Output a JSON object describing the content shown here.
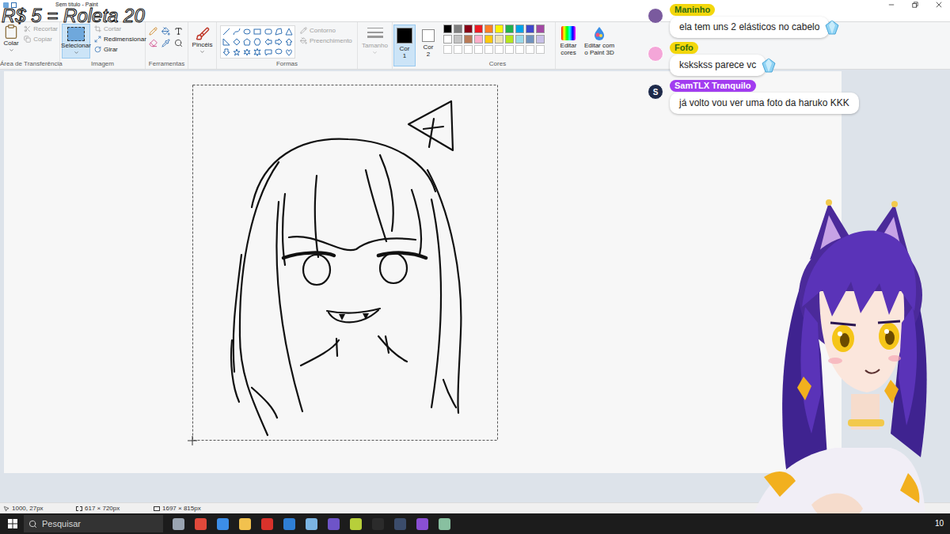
{
  "overlay": {
    "text": "R$ 5 = Roleta 20"
  },
  "window": {
    "title": "Sem título - Paint"
  },
  "ribbon": {
    "clipboard": {
      "label": "Área de Transferência",
      "paste": "Colar",
      "cut": {
        "label": "Recortar",
        "disabled": true
      },
      "copy": {
        "label": "Copiar",
        "disabled": true
      }
    },
    "image": {
      "label": "Imagem",
      "select": {
        "label": "Selecionar",
        "selected": true
      },
      "crop": {
        "label": "Cortar",
        "disabled": true
      },
      "resize": {
        "label": "Redimensionar",
        "disabled": false
      },
      "rotate": {
        "label": "Girar",
        "disabled": false
      }
    },
    "tools": {
      "label": "Ferramentas"
    },
    "brushes": {
      "label": "Pincéis"
    },
    "shapes": {
      "label": "Formas",
      "outline": {
        "label": "Contorno",
        "disabled": true
      },
      "fill": {
        "label": "Preenchimento",
        "disabled": true
      }
    },
    "size": {
      "label": "Tamanho",
      "disabled": true
    },
    "color1": {
      "label": "Cor 1",
      "color": "#000000",
      "selected": true
    },
    "color2": {
      "label": "Cor 2",
      "color": "#ffffff",
      "selected": false
    },
    "colors": {
      "label": "Cores",
      "swatches": [
        {
          "color": "#000000"
        },
        {
          "color": "#7f7f7f"
        },
        {
          "color": "#880015"
        },
        {
          "color": "#ed1c24"
        },
        {
          "color": "#ff7f27"
        },
        {
          "color": "#fff200"
        },
        {
          "color": "#22b14c"
        },
        {
          "color": "#00a2e8"
        },
        {
          "color": "#3f48cc"
        },
        {
          "color": "#a349a4"
        },
        {
          "color": "#ffffff"
        },
        {
          "color": "#c3c3c3"
        },
        {
          "color": "#b97a57"
        },
        {
          "color": "#ffaec9"
        },
        {
          "color": "#ffc90e"
        },
        {
          "color": "#efe4b0"
        },
        {
          "color": "#b5e61d"
        },
        {
          "color": "#99d9ea"
        },
        {
          "color": "#7092be"
        },
        {
          "color": "#c8bfe7"
        }
      ],
      "empty_slots": 10
    },
    "edit_colors": {
      "label": "Editar cores"
    },
    "paint3d": {
      "label": "Editar com o Paint 3D"
    }
  },
  "status_bar": {
    "cursor": "1000, 27px",
    "selection": "617 × 720px",
    "canvas": "1697 × 815px"
  },
  "chat": [
    {
      "name": "Maninho",
      "message": "ela tem uns 2 elásticos no cabelo",
      "color": "#f3d70c",
      "text_color": "#2f6b12",
      "avatar_color": "#7a5a9e",
      "avatar_letter": "",
      "gem": true
    },
    {
      "name": "Fofo",
      "message": "kskskss parece vc",
      "color": "#f3d70c",
      "text_color": "#2f6b12",
      "avatar_color": "#f4a6d8",
      "avatar_letter": "",
      "gem": true
    },
    {
      "name": "SamTLX Tranquilo",
      "message": "já volto vou ver uma foto da haruko KKK",
      "color": "#a23cf0",
      "text_color": "#ffffff",
      "avatar_color": "#1e2a4a",
      "avatar_letter": "S",
      "gem": false
    }
  ],
  "taskbar": {
    "search_placeholder": "Pesquisar",
    "clock": "10"
  }
}
